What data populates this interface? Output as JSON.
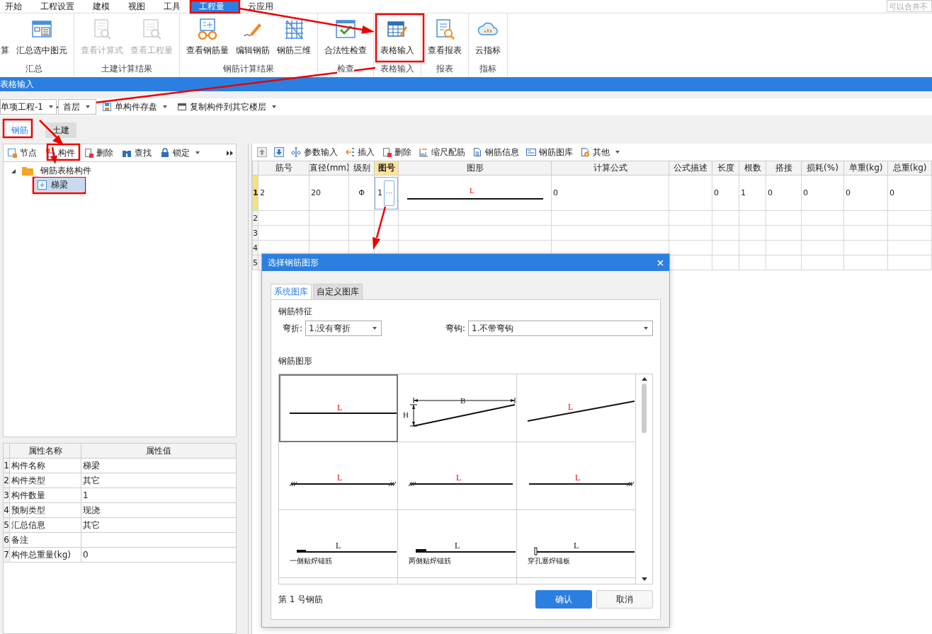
{
  "menu": {
    "tabs": [
      {
        "label": "开始",
        "selected": false
      },
      {
        "label": "工程设置",
        "selected": false
      },
      {
        "label": "建模",
        "selected": false
      },
      {
        "label": "视图",
        "selected": false
      },
      {
        "label": "工具",
        "selected": false
      },
      {
        "label": "工程量",
        "selected": true
      },
      {
        "label": "云应用",
        "selected": false
      }
    ],
    "search": {
      "placeholder": "可以合并不"
    }
  },
  "ribbon": {
    "groups": [
      {
        "label": "汇总",
        "buttons": [
          {
            "label": "算",
            "kind": "none",
            "disabled": false
          },
          {
            "label": "汇总选中图元",
            "kind": "sum",
            "disabled": false
          }
        ]
      },
      {
        "label": "土建计算结果",
        "buttons": [
          {
            "label": "查看计算式",
            "kind": "formula",
            "disabled": true
          },
          {
            "label": "查看工程量",
            "kind": "quantity",
            "disabled": true
          }
        ]
      },
      {
        "label": "钢筋计算结果",
        "buttons": [
          {
            "label": "查看钢筋量",
            "kind": "rebar-view",
            "disabled": false
          },
          {
            "label": "编辑钢筋",
            "kind": "edit",
            "disabled": false
          },
          {
            "label": "钢筋三维",
            "kind": "cage",
            "disabled": false
          }
        ]
      },
      {
        "label": "检查",
        "buttons": [
          {
            "label": "合法性检查",
            "kind": "check",
            "disabled": false
          }
        ]
      },
      {
        "label": "表格输入",
        "buttons": [
          {
            "label": "表格输入",
            "kind": "table",
            "disabled": false
          }
        ]
      },
      {
        "label": "报表",
        "buttons": [
          {
            "label": "查看报表",
            "kind": "report",
            "disabled": false
          }
        ]
      },
      {
        "label": "指标",
        "buttons": [
          {
            "label": "云指标",
            "kind": "cloud",
            "disabled": false
          }
        ]
      }
    ]
  },
  "panel_title": "表格输入",
  "toolbar": {
    "selectors": [
      {
        "value": "单项工程-1"
      },
      {
        "value": "首层"
      }
    ],
    "buttons": [
      {
        "label": "单构件存盘",
        "kind": "save"
      },
      {
        "label": "复制构件到其它楼层",
        "kind": "copy"
      }
    ]
  },
  "tabs": [
    {
      "label": "钢筋",
      "selected": true
    },
    {
      "label": "土建",
      "selected": false
    }
  ],
  "left_toolbar": {
    "buttons": [
      {
        "label": "节点",
        "kind": "node",
        "dropdown": false
      },
      {
        "label": "构件",
        "kind": "component",
        "dropdown": false
      },
      {
        "label": "删除",
        "kind": "delete",
        "dropdown": false
      },
      {
        "label": "查找",
        "kind": "find",
        "dropdown": false
      },
      {
        "label": "锁定",
        "kind": "lock",
        "dropdown": true
      }
    ]
  },
  "tree": [
    {
      "label": "钢筋表格构件",
      "expanded": true,
      "selected": false,
      "children": [
        {
          "label": "梯梁",
          "selected": true
        }
      ]
    }
  ],
  "properties": {
    "columns": [
      "属性名称",
      "属性值"
    ],
    "rows": [
      {
        "index": "1",
        "name": "构件名称",
        "value": "梯梁"
      },
      {
        "index": "2",
        "name": "构件类型",
        "value": "其它"
      },
      {
        "index": "3",
        "name": "构件数量",
        "value": "1"
      },
      {
        "index": "4",
        "name": "预制类型",
        "value": "现浇"
      },
      {
        "index": "5",
        "name": "汇总信息",
        "value": "其它"
      },
      {
        "index": "6",
        "name": "备注"
      },
      {
        "index": "7",
        "name": "构件总重量(kg)",
        "value": "0"
      }
    ]
  },
  "grid_toolbar": {
    "buttons": [
      {
        "kind": "up"
      },
      {
        "kind": "down"
      },
      {
        "label": "参数输入",
        "kind": "param",
        "dropdown": false
      },
      {
        "label": "插入",
        "kind": "insert",
        "dropdown": false
      },
      {
        "label": "删除",
        "kind": "delete",
        "dropdown": false
      },
      {
        "label": "缩尺配筋",
        "kind": "ruler",
        "dropdown": false
      },
      {
        "label": "钢筋信息",
        "kind": "info",
        "dropdown": false
      },
      {
        "label": "钢筋图库",
        "kind": "library",
        "dropdown": false
      },
      {
        "label": "其他",
        "kind": "other",
        "dropdown": true
      }
    ]
  },
  "grid": {
    "columns": [
      {
        "label": "筋号",
        "selected": false
      },
      {
        "label": "直径(mm)",
        "selected": false
      },
      {
        "label": "级别",
        "selected": false
      },
      {
        "label": "图号",
        "selected": true
      },
      {
        "label": "图形",
        "selected": false
      },
      {
        "label": "计算公式",
        "selected": false
      },
      {
        "label": "公式描述",
        "selected": false
      },
      {
        "label": "长度",
        "selected": false
      },
      {
        "label": "根数",
        "selected": false
      },
      {
        "label": "搭接",
        "selected": false
      },
      {
        "label": "损耗(%)",
        "selected": false
      },
      {
        "label": "单重(kg)",
        "selected": false
      },
      {
        "label": "总重(kg)",
        "selected": false
      }
    ],
    "rows": [
      {
        "index": "1",
        "selected": true,
        "bar_no": "2",
        "diameter": "20",
        "grade": "Φ",
        "shape_no": "1",
        "shape_button": "···",
        "shape_label": "L",
        "formula": "0",
        "length": "0",
        "count": "1",
        "lap": "0",
        "loss": "0",
        "unit_weight": "0",
        "total_weight": "0"
      },
      {
        "index": "2",
        "selected": false
      },
      {
        "index": "3",
        "selected": false
      },
      {
        "index": "4",
        "selected": false
      },
      {
        "index": "5",
        "selected": false
      }
    ]
  },
  "dialog": {
    "title": "选择钢筋图形",
    "tabs": [
      {
        "label": "系统图库",
        "selected": true
      },
      {
        "label": "自定义图库",
        "selected": false
      }
    ],
    "features_heading": "钢筋特征",
    "fields": [
      {
        "label": "弯折:",
        "value": "1.没有弯折"
      },
      {
        "label": "弯钩:",
        "value": "1.不带弯钩"
      }
    ],
    "shapes_heading": "钢筋图形",
    "shapes": [
      {
        "kind": "straight",
        "selected": true,
        "labels": [
          "L"
        ]
      },
      {
        "kind": "slope-dimensioned",
        "selected": false,
        "labels": [
          "H",
          "B"
        ]
      },
      {
        "kind": "slope",
        "selected": false,
        "labels": [
          "L"
        ]
      },
      {
        "kind": "anchor-both",
        "selected": false,
        "labels": [
          "L"
        ]
      },
      {
        "kind": "anchor-left",
        "selected": false,
        "labels": [
          "L"
        ]
      },
      {
        "kind": "anchor-right",
        "selected": false,
        "labels": [
          "L"
        ]
      },
      {
        "kind": "weld-one",
        "selected": false,
        "labels": [
          "L"
        ],
        "caption": "一侧贴焊锚筋"
      },
      {
        "kind": "weld-two",
        "selected": false,
        "labels": [
          "L"
        ],
        "caption": "两侧贴焊锚筋"
      },
      {
        "kind": "plate",
        "selected": false,
        "labels": [
          "L"
        ],
        "caption": "穿孔塞焊锚板"
      }
    ],
    "status": "第 1 号钢筋",
    "buttons": [
      {
        "label": "确认",
        "kind": "primary"
      },
      {
        "label": "取消",
        "kind": "secondary"
      }
    ]
  }
}
